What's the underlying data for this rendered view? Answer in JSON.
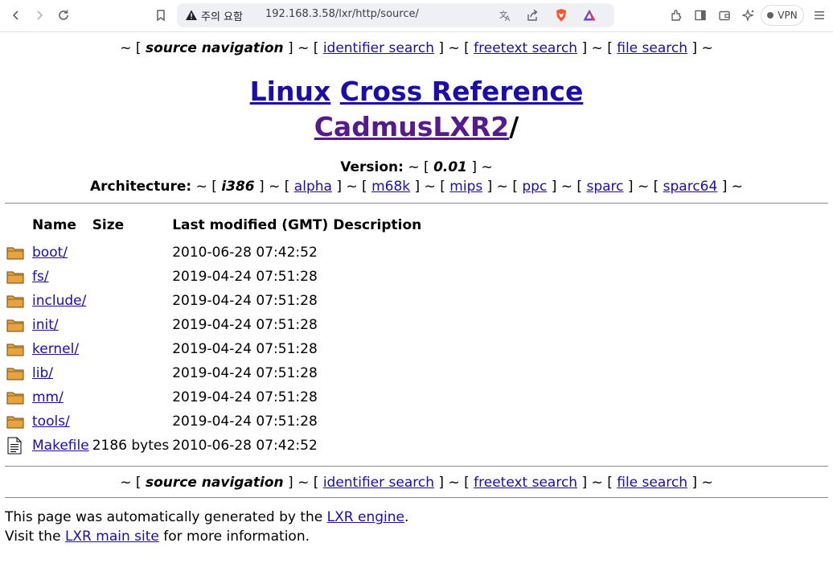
{
  "browser": {
    "security_label": "주의 요함",
    "url": "192.168.3.58/lxr/http/source/",
    "vpn_label": "VPN"
  },
  "nav": {
    "tilde": "~",
    "source_navigation": "source navigation",
    "identifier_search": "identifier search",
    "freetext_search": "freetext search",
    "file_search": "file search"
  },
  "title": {
    "linux": "Linux",
    "cross_reference": "Cross Reference",
    "tree": "CadmusLXR2",
    "slash": "/"
  },
  "version": {
    "label": "Version:",
    "current": "0.01"
  },
  "architecture": {
    "label": "Architecture:",
    "current": "i386",
    "options": [
      "alpha",
      "m68k",
      "mips",
      "ppc",
      "sparc",
      "sparc64"
    ]
  },
  "listing": {
    "headers": {
      "name": "Name",
      "size": "Size",
      "modified": "Last modified (GMT)",
      "description": "Description"
    },
    "rows": [
      {
        "name": "boot/",
        "size": "",
        "modified": "2010-06-28 07:42:52",
        "type": "folder-icon"
      },
      {
        "name": "fs/",
        "size": "",
        "modified": "2019-04-24 07:51:28",
        "type": "folder-icon"
      },
      {
        "name": "include/",
        "size": "",
        "modified": "2019-04-24 07:51:28",
        "type": "folder-icon"
      },
      {
        "name": "init/",
        "size": "",
        "modified": "2019-04-24 07:51:28",
        "type": "folder-icon"
      },
      {
        "name": "kernel/",
        "size": "",
        "modified": "2019-04-24 07:51:28",
        "type": "folder-icon"
      },
      {
        "name": "lib/",
        "size": "",
        "modified": "2019-04-24 07:51:28",
        "type": "folder-icon"
      },
      {
        "name": "mm/",
        "size": "",
        "modified": "2019-04-24 07:51:28",
        "type": "folder-icon"
      },
      {
        "name": "tools/",
        "size": "",
        "modified": "2019-04-24 07:51:28",
        "type": "folder-icon"
      },
      {
        "name": "Makefile",
        "size": "2186 bytes",
        "modified": "2010-06-28 07:42:52",
        "type": "file-icon"
      }
    ]
  },
  "footer": {
    "line1_prefix": "This page was automatically generated by the ",
    "line1_link": "LXR engine",
    "line1_suffix": ".",
    "line2_prefix": "Visit the ",
    "line2_link": "LXR main site",
    "line2_suffix": " for more information."
  },
  "colors": {
    "link": "#1a0dab",
    "visited_link": "#551a8b",
    "folder": "#e8a33d"
  }
}
